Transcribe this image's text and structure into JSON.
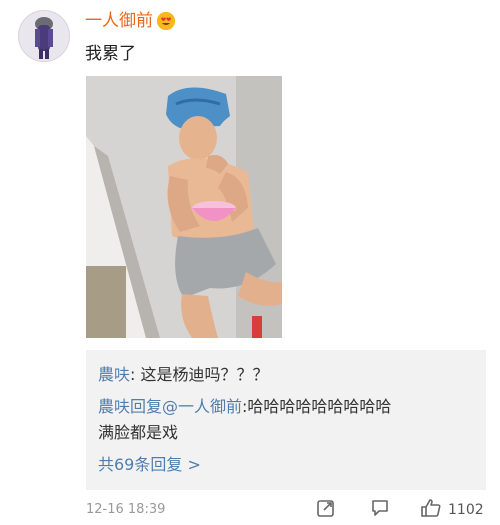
{
  "post": {
    "username": "一人御前",
    "text": "我累了",
    "image_description": ""
  },
  "comments": {
    "line1_user": "農呋",
    "line1_text": ": 这是杨迪吗？？？",
    "line2_user": "農呋回复@一人御前",
    "line2_text": ":哈哈哈哈哈哈哈哈哈",
    "line3_text": "满脸都是戏",
    "reply_count_label": "共69条回复 >"
  },
  "footer": {
    "timestamp": "12-16 18:39",
    "like_count": "1102"
  },
  "icons": {
    "vip": "emoji-heart-eyes-icon",
    "repost": "repost-icon",
    "comment": "comment-icon",
    "like": "thumbs-up-icon"
  },
  "colors": {
    "username": "#e8681a",
    "link": "#507daf",
    "comment_bg": "#f2f2f2",
    "meta": "#999999"
  }
}
